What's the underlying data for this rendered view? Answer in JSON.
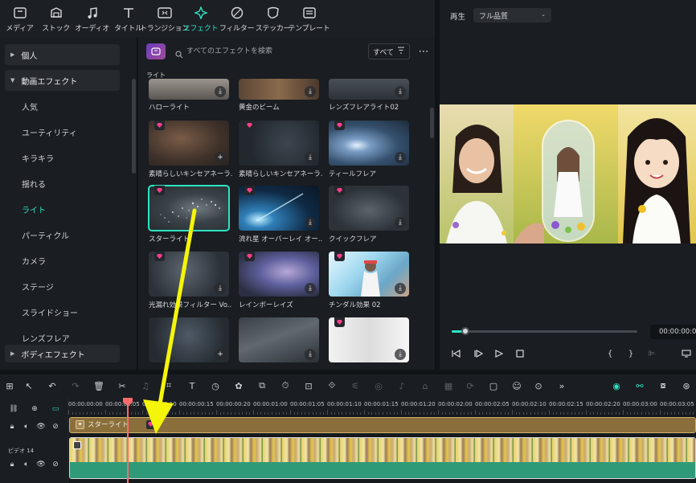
{
  "toolbar": {
    "items": [
      {
        "label": "メディア",
        "icon": "media-icon"
      },
      {
        "label": "ストック",
        "icon": "stock-icon"
      },
      {
        "label": "オーディオ",
        "icon": "audio-icon"
      },
      {
        "label": "タイトル",
        "icon": "title-icon"
      },
      {
        "label": "トランジション",
        "icon": "transition-icon"
      },
      {
        "label": "エフェクト",
        "icon": "effects-icon",
        "active": true
      },
      {
        "label": "フィルター",
        "icon": "filter-icon"
      },
      {
        "label": "ステッカー",
        "icon": "sticker-icon"
      },
      {
        "label": "テンプレート",
        "icon": "template-icon"
      }
    ]
  },
  "sidebar": {
    "group_personal": "個人",
    "group_video_effects": "動画エフェクト",
    "items": [
      "人気",
      "ユーティリティ",
      "キラキラ",
      "揺れる",
      "ライト",
      "パーティクル",
      "カメラ",
      "ステージ",
      "スライドショー",
      "レンズフレア"
    ],
    "selected": "ライト",
    "group_body_effects": "ボディエフェクト"
  },
  "effects": {
    "search_placeholder": "すべてのエフェクトを検索",
    "filter_label": "すべて",
    "section_title": "ライト",
    "cards": [
      {
        "caption": "ハローライト",
        "premium": false,
        "action": "download"
      },
      {
        "caption": "黄金のビーム",
        "premium": false,
        "action": "download"
      },
      {
        "caption": "レンズフレアライト02",
        "premium": false,
        "action": "download"
      },
      {
        "caption": "素晴らしいキンセアネーラ...",
        "premium": true,
        "action": "add"
      },
      {
        "caption": "素晴らしいキンセアネーラ...",
        "premium": true,
        "action": "download"
      },
      {
        "caption": "ティールフレア",
        "premium": true,
        "action": "download"
      },
      {
        "caption": "スターライト",
        "premium": true,
        "action": "none",
        "selected": true
      },
      {
        "caption": "流れ星 オーバーレイ オー...",
        "premium": true,
        "action": "download"
      },
      {
        "caption": "クイックフレア",
        "premium": true,
        "action": "download"
      },
      {
        "caption": "光漏れ効果フィルター Vo...",
        "premium": true,
        "action": "download"
      },
      {
        "caption": "レインボーレイズ",
        "premium": true,
        "action": "download"
      },
      {
        "caption": "チンダル効果 02",
        "premium": true,
        "action": "download"
      },
      {
        "caption": "",
        "premium": false,
        "action": "add"
      },
      {
        "caption": "",
        "premium": false,
        "action": "download"
      },
      {
        "caption": "",
        "premium": true,
        "action": "download"
      }
    ]
  },
  "player": {
    "play_label": "再生",
    "quality": "フル品質",
    "timecode": "00:00:00:08",
    "progress": 0.07
  },
  "timeline": {
    "ruler_labels": [
      "00:00:00:00",
      "00:00:00:05",
      "00:00:00:10",
      "00:00:00:15",
      "00:00:00:20",
      "00:00:01:00",
      "00:00:01:05",
      "00:00:01:10",
      "00:00:01:15",
      "00:00:01:20",
      "00:00:02:00",
      "00:00:02:05",
      "00:00:02:10",
      "00:00:02:15",
      "00:00:02:20",
      "00:00:03:00",
      "00:00:03:05"
    ],
    "effect_clip_label": "スターライト",
    "video_track_label": "ビデオ 14"
  },
  "colors": {
    "accent": "#2ee3c2",
    "premium": "#ff3d8f",
    "playhead": "#ff6a6a",
    "annotation_arrow": "#f5f50a"
  }
}
